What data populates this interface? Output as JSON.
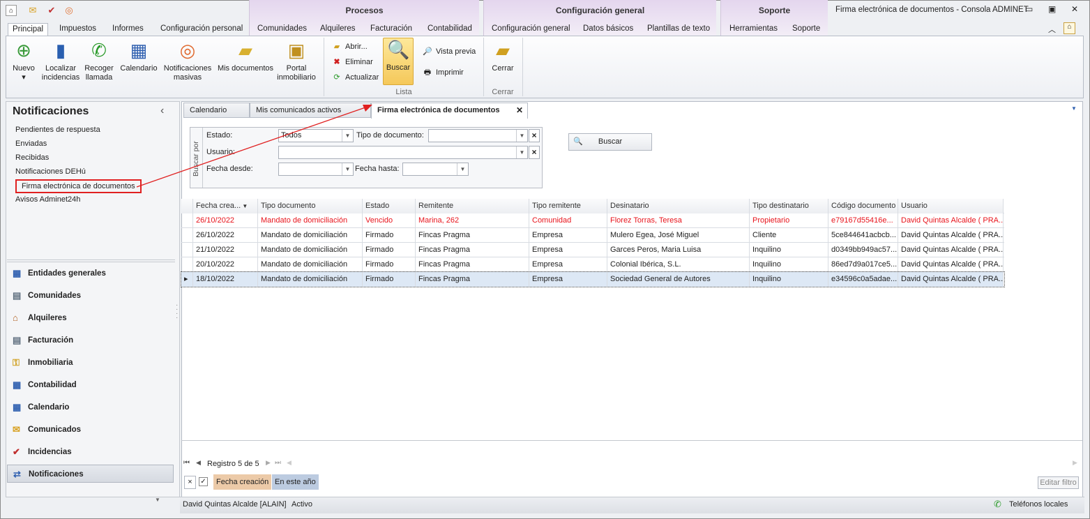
{
  "window": {
    "title": "Firma electrónica de documentos - Consola ADMINET",
    "min": "▭",
    "max": "▣",
    "close": "✕"
  },
  "context_groups": [
    "Procesos",
    "Configuración general",
    "Soporte"
  ],
  "tabs": [
    "Principal",
    "Impuestos",
    "Informes",
    "Configuración personal",
    "Comunidades",
    "Alquileres",
    "Facturación",
    "Contabilidad",
    "Configuración general",
    "Datos básicos",
    "Plantillas de texto",
    "Herramientas",
    "Soporte"
  ],
  "ribbon": {
    "big": [
      {
        "l1": "Nuevo",
        "l2": "▾",
        "icon": "📄"
      },
      {
        "l1": "Localizar",
        "l2": "incidencias",
        "icon": "🗄"
      },
      {
        "l1": "Recoger",
        "l2": "llamada",
        "icon": "📞"
      },
      {
        "l1": "Calendario",
        "l2": "",
        "icon": "📅"
      },
      {
        "l1": "Notificaciones",
        "l2": "masivas",
        "icon": "◎"
      },
      {
        "l1": "Mis documentos",
        "l2": "",
        "icon": "📂"
      },
      {
        "l1": "Portal",
        "l2": "inmobiliario",
        "icon": "🔑"
      }
    ],
    "small": {
      "abrir": "Abrir...",
      "eliminar": "Eliminar",
      "actualizar": "Actualizar",
      "buscar": "Buscar",
      "vista_previa": "Vista previa",
      "imprimir": "Imprimir",
      "cerrar": "Cerrar"
    },
    "groups": {
      "lista": "Lista",
      "cerrar": "Cerrar"
    }
  },
  "sidebar": {
    "title": "Notificaciones",
    "collapse": "‹",
    "items": [
      "Pendientes de respuesta",
      "Enviadas",
      "Recibidas",
      "Notificaciones DEHú",
      "Firma electrónica de documentos",
      "Avisos Adminet24h"
    ],
    "nav": [
      "Entidades generales",
      "Comunidades",
      "Alquileres",
      "Facturación",
      "Inmobiliaria",
      "Contabilidad",
      "Calendario",
      "Comunicados",
      "Incidencias",
      "Notificaciones"
    ]
  },
  "doc_tabs": [
    "Calendario",
    "Mis comunicados activos",
    "Firma electrónica de documentos"
  ],
  "filter": {
    "side_label": "Buscar por",
    "estado_label": "Estado:",
    "estado_value": "Todos",
    "tipo_doc_label": "Tipo de documento:",
    "tipo_doc_value": "",
    "usuario_label": "Usuario:",
    "usuario_value": "",
    "fecha_desde_label": "Fecha desde:",
    "fecha_desde_value": "",
    "fecha_hasta_label": "Fecha hasta:",
    "fecha_hasta_value": "",
    "buscar_button": "Buscar"
  },
  "grid": {
    "columns": [
      "Fecha crea...",
      "Tipo documento",
      "Estado",
      "Remitente",
      "Tipo remitente",
      "Desinatario",
      "Tipo destinatario",
      "Código documento",
      "Usuario"
    ],
    "rows": [
      [
        "26/10/2022",
        "Mandato de domiciliación",
        "Vencido",
        "Marina, 262",
        "Comunidad",
        "Florez Torras, Teresa",
        "Propietario",
        "e79167d55416e...",
        "David Quintas Alcalde ( PRA..."
      ],
      [
        "26/10/2022",
        "Mandato de domiciliación",
        "Firmado",
        "Fincas Pragma",
        "Empresa",
        "Mulero Egea, José Miguel",
        "Cliente",
        "5ce844641acbcb...",
        "David Quintas Alcalde ( PRA..."
      ],
      [
        "21/10/2022",
        "Mandato de domiciliación",
        "Firmado",
        "Fincas Pragma",
        "Empresa",
        "Garces Peros, Maria Luisa",
        "Inquilino",
        "d0349bb949ac57...",
        "David Quintas Alcalde ( PRA..."
      ],
      [
        "20/10/2022",
        "Mandato de domiciliación",
        "Firmado",
        "Fincas Pragma",
        "Empresa",
        "Colonial Ibérica, S.L.",
        "Inquilino",
        "86ed7d9a017ce5...",
        "David Quintas Alcalde ( PRA..."
      ],
      [
        "18/10/2022",
        "Mandato de domiciliación",
        "Firmado",
        "Fincas Pragma",
        "Empresa",
        "Sociedad General de Autores",
        "Inquilino",
        "e34596c0a5adae...",
        "David Quintas Alcalde ( PRA..."
      ]
    ],
    "navigator": "Registro 5 de 5",
    "filter_chips": [
      "Fecha creación",
      "En este año"
    ],
    "edit_filter": "Editar filtro"
  },
  "status": {
    "user": "David Quintas Alcalde [ALAIN]",
    "state": "Activo",
    "phones": "Teléfonos locales"
  },
  "colors": {
    "expired": "#e8141c",
    "accent": "#f5c85a",
    "annotation": "#e02020"
  }
}
